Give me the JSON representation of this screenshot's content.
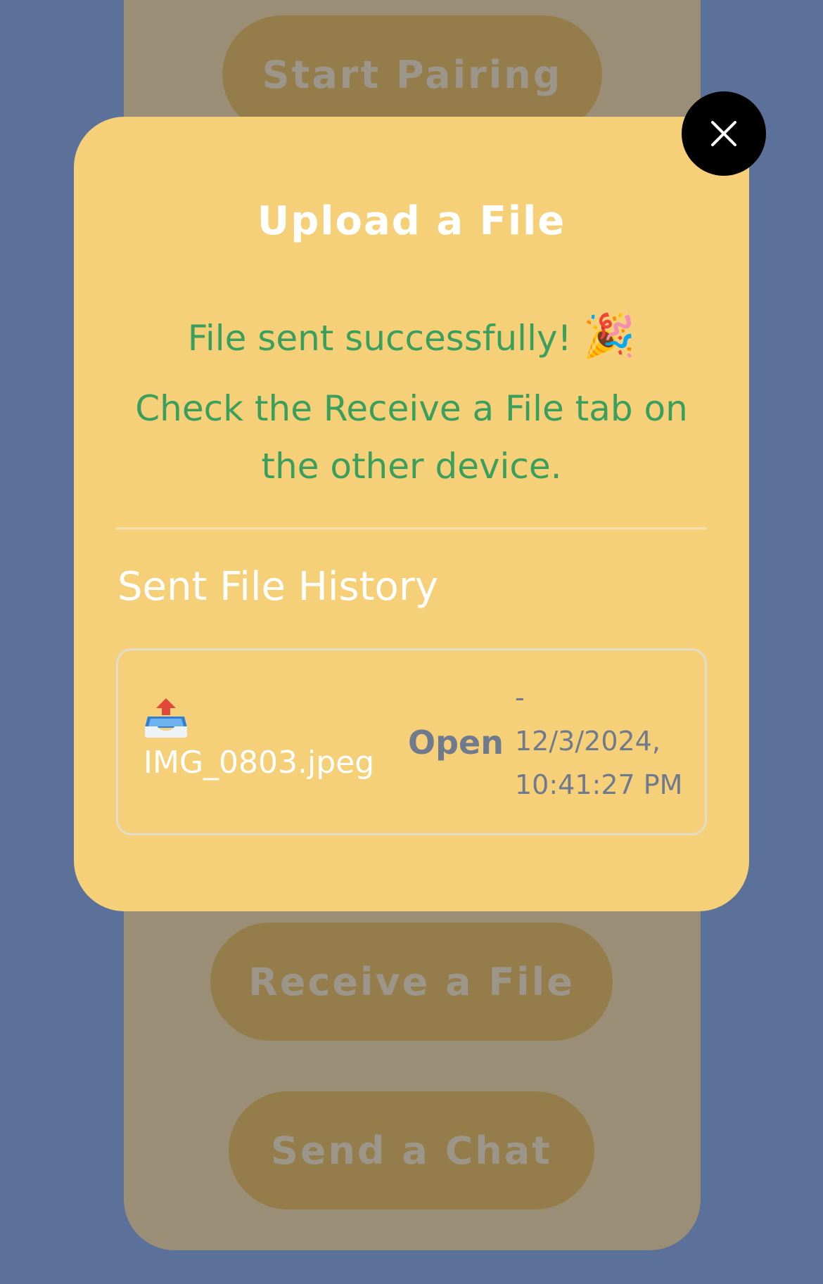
{
  "background": {
    "buttons": {
      "start_pairing": "Start Pairing",
      "receive_file": "Receive a File",
      "send_chat": "Send a Chat"
    }
  },
  "modal": {
    "title": "Upload a File",
    "success_message": "File sent successfully!",
    "success_emoji": "🎉",
    "instruction": "Check the Receive a File tab on the other device.",
    "close_icon": "close-icon",
    "history": {
      "heading": "Sent File History",
      "items": [
        {
          "icon": "outbox-tray-icon",
          "file_name": "IMG_0803.jpeg",
          "action": "Open",
          "separator": "-",
          "date": "12/3/2024,",
          "time": "10:41:27 PM"
        }
      ]
    }
  },
  "colors": {
    "page_background": "#5b7199",
    "modal_background": "#f5d078",
    "success_text": "#3a9f5c",
    "close_button": "#000000",
    "muted_text": "#707a8e"
  }
}
